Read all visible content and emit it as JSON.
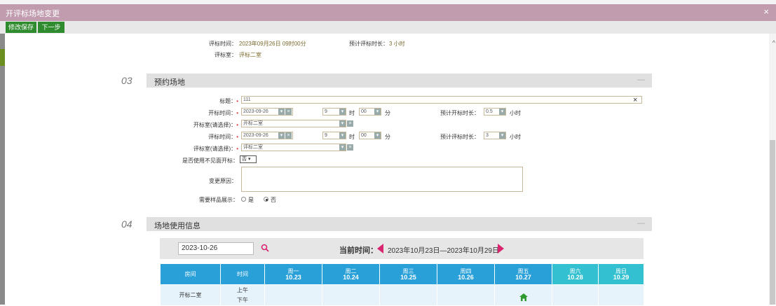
{
  "window": {
    "title": "开评标场地变更",
    "close_label": "×"
  },
  "toolbar": {
    "save_label": "修改保存",
    "next_label": "下一步"
  },
  "top_info": {
    "eval_time_label": "评标时间：",
    "eval_time_value": "2023年09月26日 09时00分",
    "est_duration_label": "预计评标时长：",
    "est_duration_value": "3 小时",
    "eval_room_label": "评标室：",
    "eval_room_value": "评标二室"
  },
  "sections": [
    {
      "num": "03",
      "title": "预约场地",
      "collapse": "—"
    },
    {
      "num": "04",
      "title": "场地使用信息",
      "collapse": "—"
    }
  ],
  "booking": {
    "title_label": "标题：",
    "title_value": "111",
    "clear_icon": "×",
    "open_time_label": "开标时间：",
    "open_date": "2023-09-26",
    "open_hour": "9",
    "hour_unit": "时",
    "open_min": "00",
    "min_unit": "分",
    "open_duration_label": "预计开标时长：",
    "open_duration_value": "0.5",
    "hour_word": "小时",
    "open_room_label": "开标室(请选择)：",
    "open_room_value": "开标二室",
    "eval_time_label": "评标时间：",
    "eval_date": "2023-09-26",
    "eval_hour": "9",
    "eval_min": "00",
    "eval_duration_label": "预计评标时长：",
    "eval_duration_value": "3",
    "eval_room_label": "评标室(请选择)：",
    "eval_room_value": "评标二室",
    "remote_label": "是否使用不见面开标：",
    "remote_value": "否",
    "reason_label": "变更原因：",
    "sample_label": "需要样品展示：",
    "sample_yes": "是",
    "sample_no": "否",
    "required_mark": "•"
  },
  "calendar": {
    "date_input": "2023-10-26",
    "current_label": "当前时间：",
    "range": "2023年10月23日—2023年10月29日",
    "headers": [
      {
        "top": "房间",
        "bottom": ""
      },
      {
        "top": "时间",
        "bottom": ""
      },
      {
        "top": "周一",
        "bottom": "10.23"
      },
      {
        "top": "周二",
        "bottom": "10.24"
      },
      {
        "top": "周三",
        "bottom": "10.25"
      },
      {
        "top": "周四",
        "bottom": "10.26"
      },
      {
        "top": "周五",
        "bottom": "10.27"
      },
      {
        "top": "周六",
        "bottom": "10.28"
      },
      {
        "top": "周日",
        "bottom": "10.29"
      }
    ],
    "row_room": "开标二室",
    "row_am": "上午",
    "row_pm": "下午"
  },
  "colors": {
    "title_bar": "#c09cae",
    "toolbar_button": "#2e8b2e",
    "table_header": "#2aa0d9",
    "weekend_header": "#33c0d0",
    "arrow": "#d9256f",
    "home_icon": "#2e9a2e"
  },
  "icons": {
    "search": "search-icon",
    "prev": "arrow-left-icon",
    "next": "arrow-right-icon",
    "home": "home-icon"
  }
}
